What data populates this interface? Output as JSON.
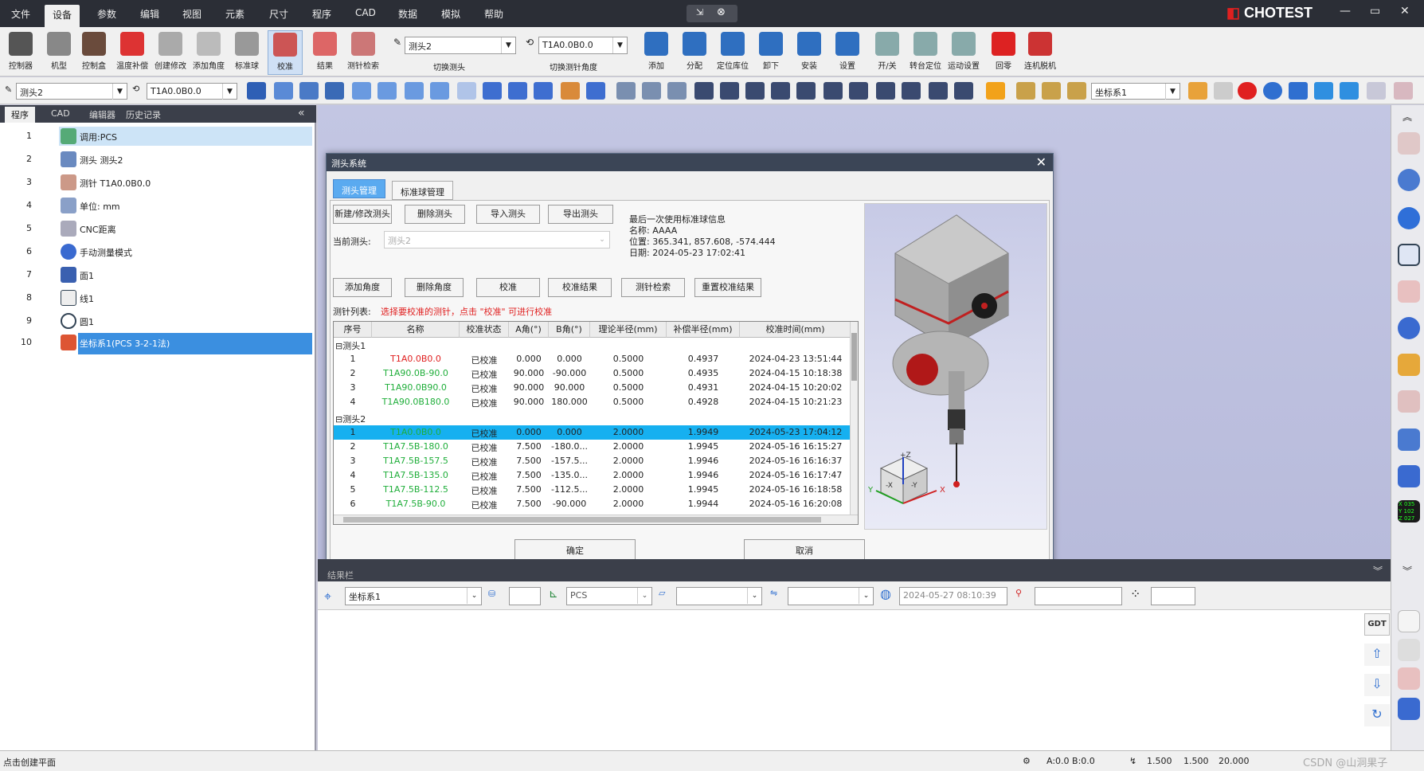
{
  "menu": {
    "items": [
      "文件",
      "设备",
      "参数",
      "编辑",
      "视图",
      "元素",
      "尺寸",
      "程序",
      "CAD",
      "数据",
      "模拟",
      "帮助"
    ],
    "active_index": 1
  },
  "brand": {
    "logo": "CHOTEST",
    "accent": "#e02020"
  },
  "ribbon": {
    "buttons": [
      "控制器",
      "机型",
      "控制盒",
      "温度补偿",
      "创建修改",
      "添加角度",
      "标准球",
      "校准",
      "结果",
      "测针检索"
    ],
    "selected": "校准",
    "probe_combo_value": "测头2",
    "probe_combo_caption": "切换测头",
    "tip_combo_value": "T1A0.0B0.0",
    "tip_combo_caption": "切换测针角度",
    "right_buttons": [
      "添加",
      "分配",
      "定位库位",
      "卸下",
      "安装",
      "设置",
      "开/关",
      "转台定位",
      "运动设置",
      "回零",
      "连机脱机"
    ]
  },
  "toolbar2": {
    "probe_value": "测头2",
    "tip_value": "T1A0.0B0.0",
    "coord_value": "坐标系1"
  },
  "left_panel": {
    "tabs": [
      "程序",
      "CAD",
      "编辑器",
      "历史记录"
    ],
    "rows": [
      {
        "num": "1",
        "label": "调用:PCS",
        "icon": "call-pcs-icon"
      },
      {
        "num": "2",
        "label": "测头 测头2",
        "icon": "probe-icon"
      },
      {
        "num": "3",
        "label": "测针 T1A0.0B0.0",
        "icon": "stylus-icon"
      },
      {
        "num": "4",
        "label": "单位: mm",
        "icon": "unit-icon"
      },
      {
        "num": "5",
        "label": "CNC距离",
        "icon": "cnc-distance-icon"
      },
      {
        "num": "6",
        "label": "手动测量模式",
        "icon": "hand-icon"
      },
      {
        "num": "7",
        "label": "面1",
        "icon": "plane-icon"
      },
      {
        "num": "8",
        "label": "线1",
        "icon": "line-icon"
      },
      {
        "num": "9",
        "label": "圆1",
        "icon": "circle-icon"
      },
      {
        "num": "10",
        "label": "坐标系1(PCS  3-2-1法)",
        "icon": "coord-system-icon"
      }
    ]
  },
  "dialog": {
    "title": "测头系统",
    "tabs": [
      "测头管理",
      "标准球管理"
    ],
    "top_buttons": [
      "新建/修改测头",
      "删除测头",
      "导入测头",
      "导出测头"
    ],
    "current_probe_label": "当前测头:",
    "current_probe_value": "测头2",
    "sphere_info": {
      "heading": "最后一次使用标准球信息",
      "name": "名称: AAAA",
      "position": "位置: 365.341, 857.608, -574.444",
      "date": "日期: 2024-05-23 17:02:41"
    },
    "mid_buttons": [
      "添加角度",
      "删除角度",
      "校准",
      "校准结果",
      "测针检索",
      "重置校准结果"
    ],
    "list_label": "测针列表:",
    "list_hint": "选择要校准的测针，点击 \"校准\" 可进行校准",
    "columns": [
      "序号",
      "名称",
      "校准状态",
      "A角(°)",
      "B角(°)",
      "理论半径(mm)",
      "补偿半径(mm)",
      "校准时间(mm)"
    ],
    "groups": [
      {
        "name": "测头1",
        "rows": [
          {
            "n": "1",
            "name": "T1A0.0B0.0",
            "status": "已校准",
            "a": "0.000",
            "b": "0.000",
            "r": "0.5000",
            "c": "0.4937",
            "t": "2024-04-23 13:51:44",
            "color": "red"
          },
          {
            "n": "2",
            "name": "T1A90.0B-90.0",
            "status": "已校准",
            "a": "90.000",
            "b": "-90.000",
            "r": "0.5000",
            "c": "0.4935",
            "t": "2024-04-15 10:18:38",
            "color": "green"
          },
          {
            "n": "3",
            "name": "T1A90.0B90.0",
            "status": "已校准",
            "a": "90.000",
            "b": "90.000",
            "r": "0.5000",
            "c": "0.4931",
            "t": "2024-04-15 10:20:02",
            "color": "green"
          },
          {
            "n": "4",
            "name": "T1A90.0B180.0",
            "status": "已校准",
            "a": "90.000",
            "b": "180.000",
            "r": "0.5000",
            "c": "0.4928",
            "t": "2024-04-15 10:21:23",
            "color": "green"
          }
        ]
      },
      {
        "name": "测头2",
        "rows": [
          {
            "n": "1",
            "name": "T1A0.0B0.0",
            "status": "已校准",
            "a": "0.000",
            "b": "0.000",
            "r": "2.0000",
            "c": "1.9949",
            "t": "2024-05-23 17:04:12",
            "color": "green",
            "selected": true
          },
          {
            "n": "2",
            "name": "T1A7.5B-180.0",
            "status": "已校准",
            "a": "7.500",
            "b": "-180.0...",
            "r": "2.0000",
            "c": "1.9945",
            "t": "2024-05-16 16:15:27",
            "color": "green"
          },
          {
            "n": "3",
            "name": "T1A7.5B-157.5",
            "status": "已校准",
            "a": "7.500",
            "b": "-157.5...",
            "r": "2.0000",
            "c": "1.9946",
            "t": "2024-05-16 16:16:37",
            "color": "green"
          },
          {
            "n": "4",
            "name": "T1A7.5B-135.0",
            "status": "已校准",
            "a": "7.500",
            "b": "-135.0...",
            "r": "2.0000",
            "c": "1.9946",
            "t": "2024-05-16 16:17:47",
            "color": "green"
          },
          {
            "n": "5",
            "name": "T1A7.5B-112.5",
            "status": "已校准",
            "a": "7.500",
            "b": "-112.5...",
            "r": "2.0000",
            "c": "1.9945",
            "t": "2024-05-16 16:18:58",
            "color": "green"
          },
          {
            "n": "6",
            "name": "T1A7.5B-90.0",
            "status": "已校准",
            "a": "7.500",
            "b": "-90.000",
            "r": "2.0000",
            "c": "1.9944",
            "t": "2024-05-16 16:20:08",
            "color": "green"
          }
        ]
      }
    ],
    "ok": "确定",
    "cancel": "取消",
    "preview_axes": {
      "x": "X",
      "y": "Y",
      "z": "+Z",
      "cube_labels": [
        "-X",
        "-Y"
      ]
    }
  },
  "lower": {
    "header": "结果栏",
    "coord": "坐标系1",
    "pcs": "PCS",
    "timestamp": "2024-05-27 08:10:39"
  },
  "status": {
    "left": "点击创建平面",
    "ab": "A:0.0  B:0.0",
    "scales": [
      "1.500",
      "1.500",
      "20.000"
    ],
    "watermark": "CSDN @山洞果子"
  },
  "right_side_labels": {
    "gdt": "GDT",
    "coords": [
      "X 035",
      "Y 102",
      "Z 027"
    ]
  }
}
